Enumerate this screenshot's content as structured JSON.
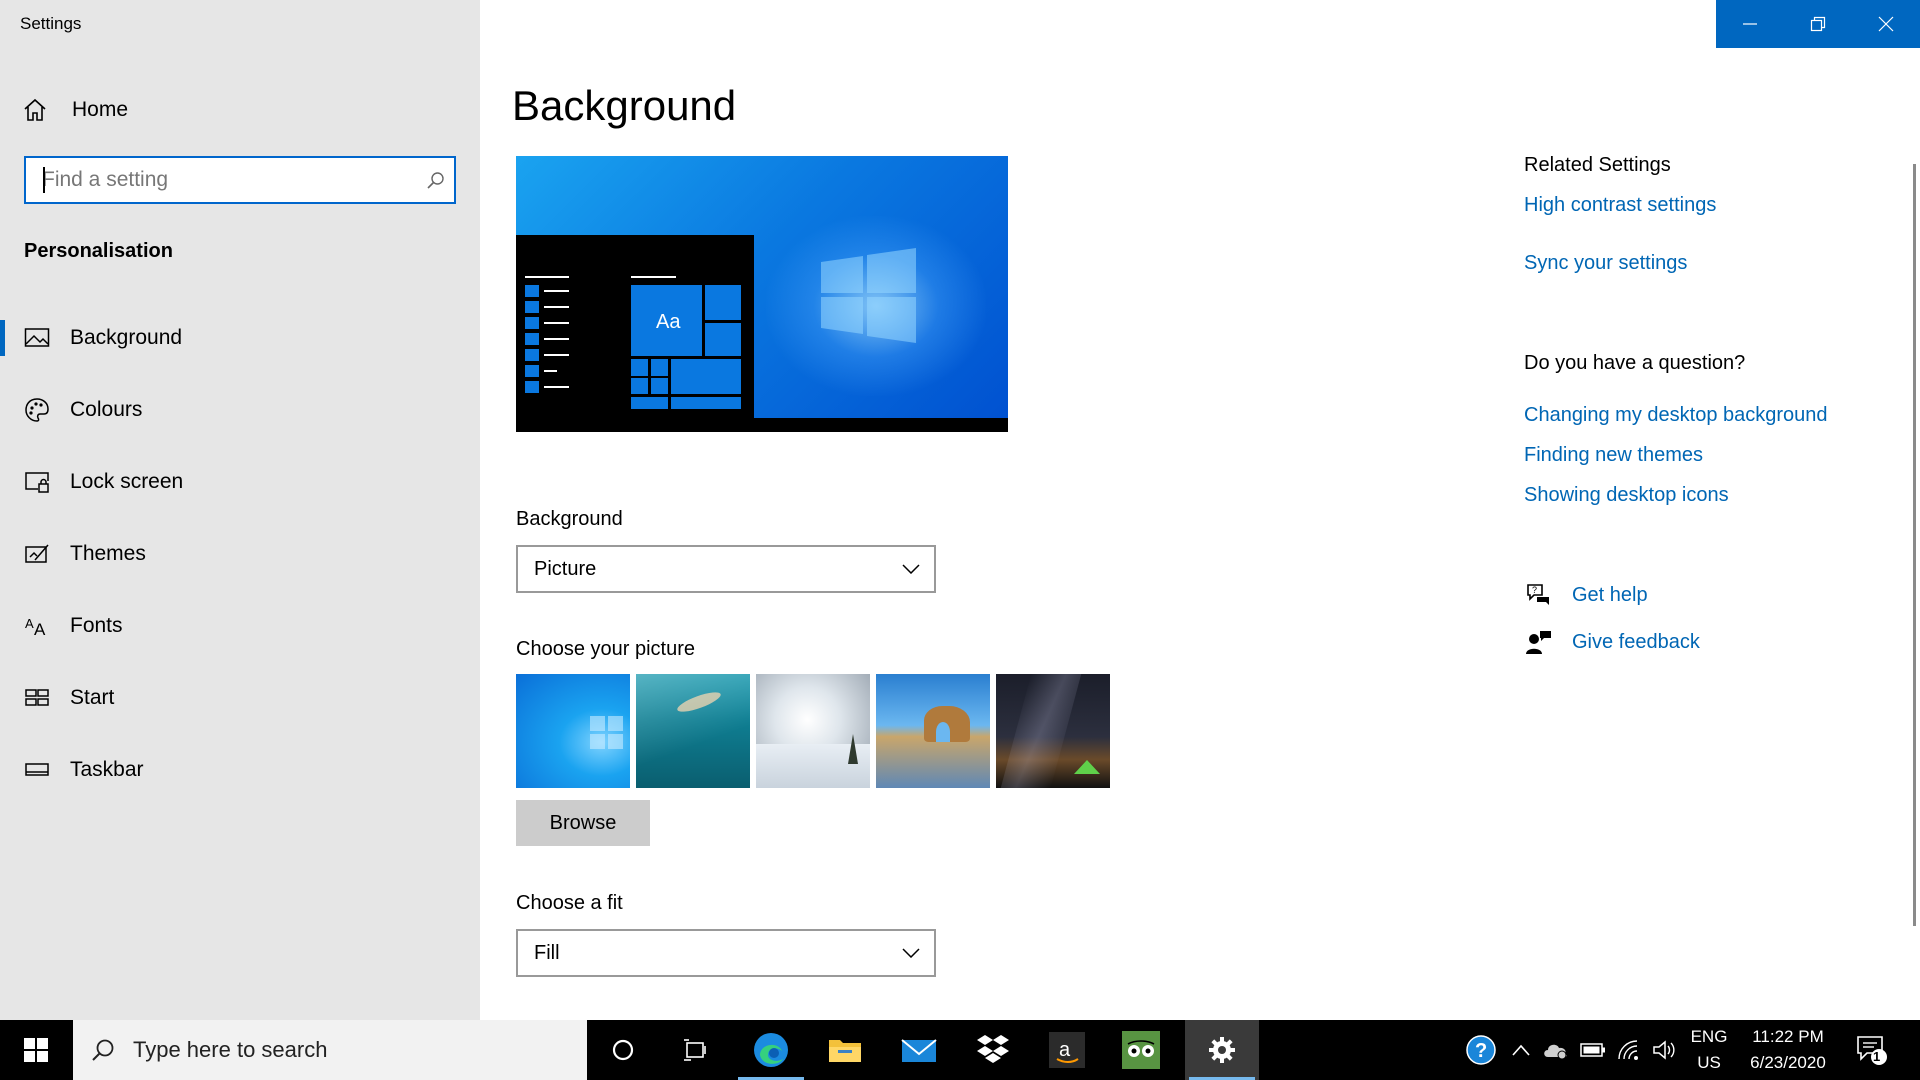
{
  "app": {
    "title": "Settings"
  },
  "sidebar": {
    "home_label": "Home",
    "search_placeholder": "Find a setting",
    "section_heading": "Personalisation",
    "items": [
      {
        "label": "Background",
        "icon": "picture-icon",
        "selected": true
      },
      {
        "label": "Colours",
        "icon": "palette-icon",
        "selected": false
      },
      {
        "label": "Lock screen",
        "icon": "lock-screen-icon",
        "selected": false
      },
      {
        "label": "Themes",
        "icon": "themes-icon",
        "selected": false
      },
      {
        "label": "Fonts",
        "icon": "fonts-icon",
        "selected": false
      },
      {
        "label": "Start",
        "icon": "start-icon",
        "selected": false
      },
      {
        "label": "Taskbar",
        "icon": "taskbar-icon",
        "selected": false
      }
    ]
  },
  "main": {
    "title": "Background",
    "preview": {
      "sample_text": "Aa"
    },
    "background_label": "Background",
    "background_value": "Picture",
    "choose_picture_label": "Choose your picture",
    "browse_label": "Browse",
    "fit_label": "Choose a fit",
    "fit_value": "Fill"
  },
  "related": {
    "heading": "Related Settings",
    "links": [
      "High contrast settings",
      "Sync your settings"
    ],
    "question_heading": "Do you have a question?",
    "question_links": [
      "Changing my desktop background",
      "Finding new themes",
      "Showing desktop icons"
    ],
    "get_help": "Get help",
    "give_feedback": "Give feedback"
  },
  "taskbar": {
    "search_placeholder": "Type here to search",
    "language_top": "ENG",
    "language_bottom": "US",
    "time": "11:22 PM",
    "date": "6/23/2020",
    "notification_count": "1",
    "pinned": [
      "cortana-icon",
      "task-view-icon",
      "edge-icon",
      "file-explorer-icon",
      "mail-icon",
      "dropbox-icon",
      "amazon-icon",
      "tripadvisor-icon",
      "settings-icon"
    ]
  },
  "colors": {
    "accent": "#0067c0",
    "link": "#0066b4",
    "sidebar_bg": "#e6e6e6"
  }
}
